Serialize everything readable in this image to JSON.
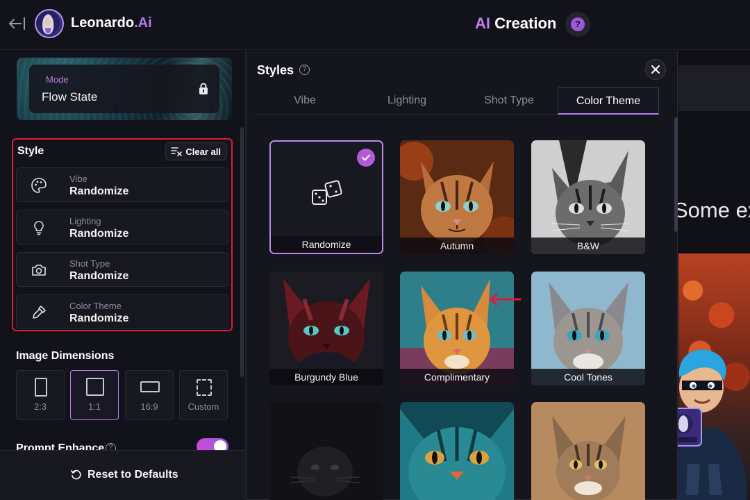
{
  "app": {
    "brand_name": "Leonardo",
    "brand_suffix": ".Ai",
    "page_title_prefix": "AI",
    "page_title_suffix": " Creation",
    "help_glyph": "?"
  },
  "mode": {
    "label": "Mode",
    "value": "Flow State"
  },
  "style_section": {
    "title": "Style",
    "clear_all": "Clear all",
    "rows": [
      {
        "label": "Vibe",
        "value": "Randomize",
        "icon": "palette-icon"
      },
      {
        "label": "Lighting",
        "value": "Randomize",
        "icon": "lightbulb-icon"
      },
      {
        "label": "Shot Type",
        "value": "Randomize",
        "icon": "camera-icon"
      },
      {
        "label": "Color Theme",
        "value": "Randomize",
        "icon": "eyedropper-icon"
      }
    ]
  },
  "dimensions": {
    "title": "Image Dimensions",
    "options": [
      {
        "label": "2:3",
        "active": false
      },
      {
        "label": "1:1",
        "active": true
      },
      {
        "label": "16:9",
        "active": false
      },
      {
        "label": "Custom",
        "active": false
      }
    ]
  },
  "prompt_enhance": {
    "label": "Prompt Enhance",
    "enabled": true
  },
  "footer": {
    "reset_label": "Reset to Defaults"
  },
  "styles_modal": {
    "title": "Styles",
    "tabs": [
      "Vibe",
      "Lighting",
      "Shot Type",
      "Color Theme"
    ],
    "active_tab": "Color Theme",
    "tiles": [
      {
        "label": "Randomize",
        "selected": true
      },
      {
        "label": "Autumn",
        "selected": false
      },
      {
        "label": "B&W",
        "selected": false
      },
      {
        "label": "Burgundy Blue",
        "selected": false
      },
      {
        "label": "Complimentary",
        "selected": false
      },
      {
        "label": "Cool Tones",
        "selected": false
      },
      {
        "label": "",
        "selected": false
      },
      {
        "label": "",
        "selected": false
      },
      {
        "label": "",
        "selected": false
      }
    ]
  },
  "background": {
    "partial_text": "Some ex"
  },
  "colors": {
    "accent": "#b57ef0",
    "highlight_border": "#e5173a",
    "background": "#0f0f17",
    "panel": "#12121a"
  }
}
